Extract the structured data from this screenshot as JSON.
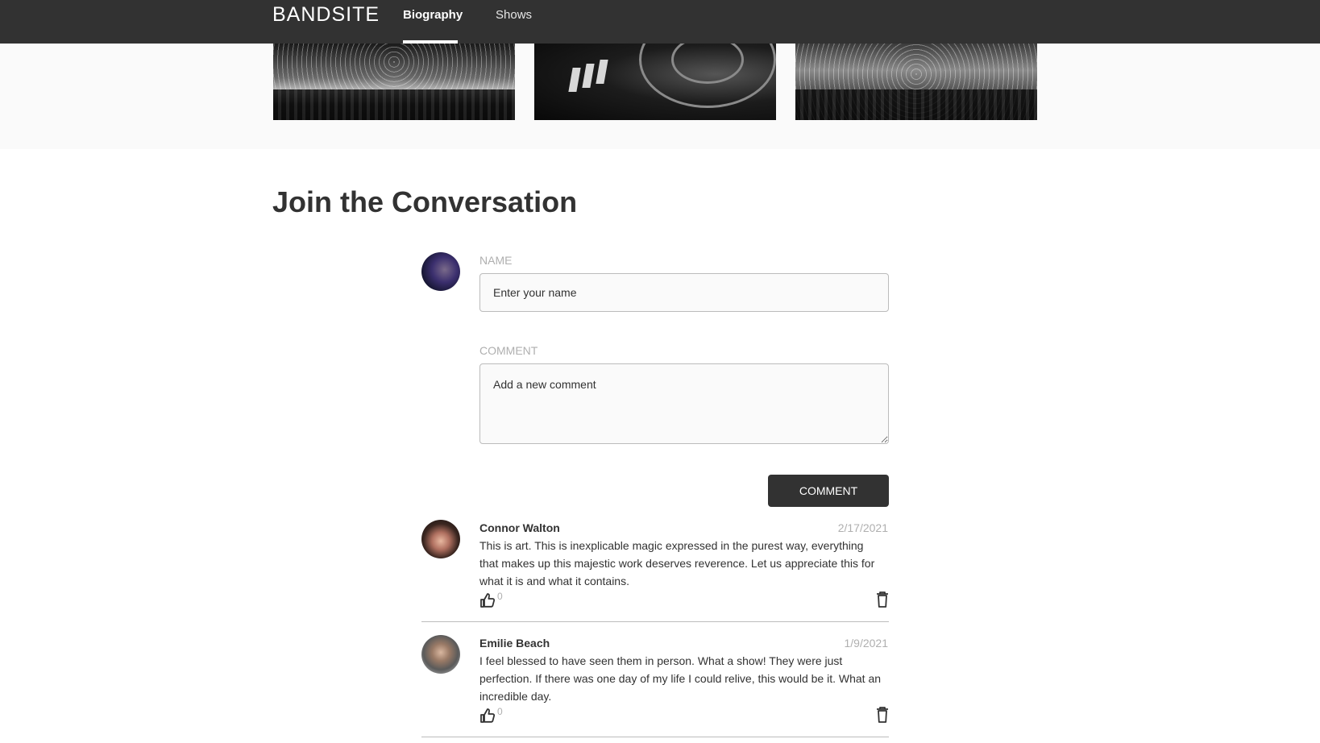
{
  "header": {
    "logo": "BANDSITE",
    "nav": [
      {
        "label": "Biography",
        "active": true
      },
      {
        "label": "Shows",
        "active": false
      }
    ]
  },
  "gallery": {
    "images": [
      "concert-crowd",
      "dj-turntable",
      "confetti-crowd"
    ]
  },
  "conversation": {
    "title": "Join the Conversation",
    "form": {
      "name_label": "NAME",
      "name_placeholder": "Enter your name",
      "comment_label": "COMMENT",
      "comment_placeholder": "Add a new comment",
      "submit_label": "COMMENT"
    },
    "comments": [
      {
        "name": "Connor Walton",
        "date": "2/17/2021",
        "text": "This is art. This is inexplicable magic expressed in the purest way, everything that makes up this majestic work deserves reverence. Let us appreciate this for what it is and what it contains.",
        "likes": "0"
      },
      {
        "name": "Emilie Beach",
        "date": "1/9/2021",
        "text": "I feel blessed to have seen them in person. What a show! They were just perfection. If there was one day of my life I could relive, this would be it. What an incredible day.",
        "likes": "0"
      }
    ]
  },
  "colors": {
    "header_bg": "#323232",
    "muted": "#afafaf",
    "text": "#323232"
  }
}
